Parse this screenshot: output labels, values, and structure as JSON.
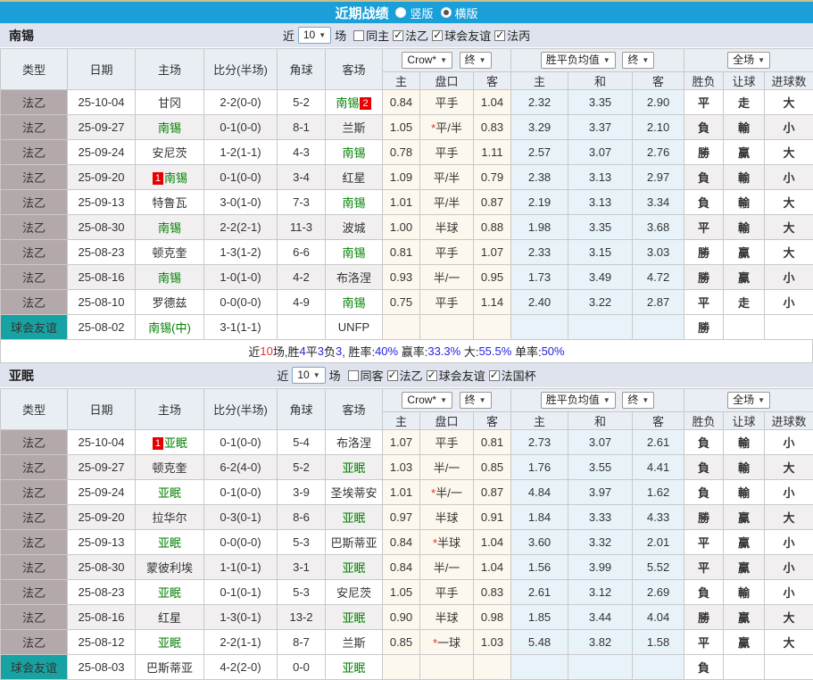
{
  "title_bar": {
    "title": "近期战绩",
    "radios": [
      {
        "label": "竖版",
        "checked": false
      },
      {
        "label": "横版",
        "checked": true
      }
    ]
  },
  "header": {
    "type": "类型",
    "date": "日期",
    "home_field": "主场",
    "score": "比分(半场)",
    "corners": "角球",
    "away_field": "客场",
    "home": "主",
    "handicap": "盘口",
    "away": "客",
    "draw": "和",
    "wdl": "胜负",
    "handicap_result": "让球",
    "goals": "进球数",
    "book": "Crow*",
    "final": "终",
    "avg": "胜平负均值",
    "full": "全场"
  },
  "colors": {
    "titlebar_blue": "#1b9fd8",
    "league_cell": "#b3a9ab",
    "friendly_cell": "#17a3a3",
    "score_red": "#e62e2e",
    "team_green": "#008000",
    "win_red": "#cc0000",
    "lose_green": "#008000",
    "draw_blue": "#0000e0",
    "odds_cream_bg": "#fcf8ed",
    "odds_blue_bg": "#e8f3f9"
  },
  "sections": [
    {
      "team": "南锡",
      "filters": {
        "near": "近",
        "count": "10",
        "matches": "场",
        "checks": [
          {
            "label": "同主",
            "checked": false
          },
          {
            "label": "法乙",
            "checked": true
          },
          {
            "label": "球会友谊",
            "checked": true
          },
          {
            "label": "法丙",
            "checked": true
          }
        ]
      },
      "rows": [
        {
          "type": "法乙",
          "date": "25-10-04",
          "home": {
            "t": "甘冈"
          },
          "score": "2-2(0-0)",
          "corner": "5-2",
          "away": {
            "t": "南锡",
            "g": true,
            "br": "2"
          },
          "odds": [
            "0.84",
            "平手",
            "1.04",
            "2.32",
            "3.35",
            "2.90"
          ],
          "results": [
            [
              "平",
              "b"
            ],
            [
              "走",
              "b"
            ],
            [
              "大",
              "r"
            ]
          ]
        },
        {
          "type": "法乙",
          "date": "25-09-27",
          "home": {
            "t": "南锡",
            "g": true
          },
          "score": "0-1(0-0)",
          "corner": "8-1",
          "away": {
            "t": "兰斯"
          },
          "odds": [
            "1.05",
            "*平/半",
            "0.83",
            "3.29",
            "3.37",
            "2.10"
          ],
          "results": [
            [
              "負",
              "g"
            ],
            [
              "輸",
              "g"
            ],
            [
              "小",
              "g"
            ]
          ]
        },
        {
          "type": "法乙",
          "date": "25-09-24",
          "home": {
            "t": "安尼茨"
          },
          "score": "1-2(1-1)",
          "corner": "4-3",
          "away": {
            "t": "南锡",
            "g": true
          },
          "odds": [
            "0.78",
            "平手",
            "1.11",
            "2.57",
            "3.07",
            "2.76"
          ],
          "results": [
            [
              "勝",
              "r"
            ],
            [
              "贏",
              "r"
            ],
            [
              "大",
              "r"
            ]
          ]
        },
        {
          "type": "法乙",
          "date": "25-09-20",
          "home": {
            "t": "南锡",
            "g": true,
            "bl": "1"
          },
          "score": "0-1(0-0)",
          "corner": "3-4",
          "away": {
            "t": "红星"
          },
          "odds": [
            "1.09",
            "平/半",
            "0.79",
            "2.38",
            "3.13",
            "2.97"
          ],
          "results": [
            [
              "負",
              "g"
            ],
            [
              "輸",
              "g"
            ],
            [
              "小",
              "g"
            ]
          ]
        },
        {
          "type": "法乙",
          "date": "25-09-13",
          "home": {
            "t": "特鲁瓦"
          },
          "score": "3-0(1-0)",
          "corner": "7-3",
          "away": {
            "t": "南锡",
            "g": true
          },
          "odds": [
            "1.01",
            "平/半",
            "0.87",
            "2.19",
            "3.13",
            "3.34"
          ],
          "results": [
            [
              "負",
              "g"
            ],
            [
              "輸",
              "g"
            ],
            [
              "大",
              "r"
            ]
          ]
        },
        {
          "type": "法乙",
          "date": "25-08-30",
          "home": {
            "t": "南锡",
            "g": true
          },
          "score": "2-2(2-1)",
          "corner": "11-3",
          "away": {
            "t": "波城"
          },
          "odds": [
            "1.00",
            "半球",
            "0.88",
            "1.98",
            "3.35",
            "3.68"
          ],
          "results": [
            [
              "平",
              "b"
            ],
            [
              "輸",
              "g"
            ],
            [
              "大",
              "r"
            ]
          ]
        },
        {
          "type": "法乙",
          "date": "25-08-23",
          "home": {
            "t": "顿克奎"
          },
          "score": "1-3(1-2)",
          "corner": "6-6",
          "away": {
            "t": "南锡",
            "g": true
          },
          "odds": [
            "0.81",
            "平手",
            "1.07",
            "2.33",
            "3.15",
            "3.03"
          ],
          "results": [
            [
              "勝",
              "r"
            ],
            [
              "贏",
              "r"
            ],
            [
              "大",
              "r"
            ]
          ]
        },
        {
          "type": "法乙",
          "date": "25-08-16",
          "home": {
            "t": "南锡",
            "g": true
          },
          "score": "1-0(1-0)",
          "corner": "4-2",
          "away": {
            "t": "布洛涅"
          },
          "odds": [
            "0.93",
            "半/一",
            "0.95",
            "1.73",
            "3.49",
            "4.72"
          ],
          "results": [
            [
              "勝",
              "r"
            ],
            [
              "贏",
              "r"
            ],
            [
              "小",
              "g"
            ]
          ]
        },
        {
          "type": "法乙",
          "date": "25-08-10",
          "home": {
            "t": "罗德兹"
          },
          "score": "0-0(0-0)",
          "corner": "4-9",
          "away": {
            "t": "南锡",
            "g": true
          },
          "odds": [
            "0.75",
            "平手",
            "1.14",
            "2.40",
            "3.22",
            "2.87"
          ],
          "results": [
            [
              "平",
              "b"
            ],
            [
              "走",
              "b"
            ],
            [
              "小",
              "g"
            ]
          ]
        },
        {
          "type": "球会友谊",
          "friendly": true,
          "date": "25-08-02",
          "home": {
            "t": "南锡(中)",
            "g": true
          },
          "score": "3-1(1-1)",
          "corner": "",
          "away": {
            "t": "UNFP"
          },
          "odds": [
            "",
            "",
            "",
            "",
            "",
            ""
          ],
          "results": [
            [
              "勝",
              "r"
            ],
            [
              "",
              ""
            ],
            [
              "",
              ""
            ]
          ]
        }
      ],
      "summary": [
        {
          "t": "近",
          "c": "k"
        },
        {
          "t": "10",
          "c": "r"
        },
        {
          "t": "场,胜",
          "c": "k"
        },
        {
          "t": "4",
          "c": "b"
        },
        {
          "t": "平",
          "c": "k"
        },
        {
          "t": "3",
          "c": "b"
        },
        {
          "t": "负",
          "c": "k"
        },
        {
          "t": "3",
          "c": "b"
        },
        {
          "t": ", 胜率:",
          "c": "k"
        },
        {
          "t": "40%",
          "c": "b"
        },
        {
          "t": " 赢率:",
          "c": "k"
        },
        {
          "t": "33.3%",
          "c": "b"
        },
        {
          "t": " 大:",
          "c": "k"
        },
        {
          "t": "55.5%",
          "c": "b"
        },
        {
          "t": " 单率:",
          "c": "k"
        },
        {
          "t": "50%",
          "c": "b"
        }
      ]
    },
    {
      "team": "亚眠",
      "filters": {
        "near": "近",
        "count": "10",
        "matches": "场",
        "checks": [
          {
            "label": "同客",
            "checked": false
          },
          {
            "label": "法乙",
            "checked": true
          },
          {
            "label": "球会友谊",
            "checked": true
          },
          {
            "label": "法国杯",
            "checked": true
          }
        ]
      },
      "rows": [
        {
          "type": "法乙",
          "date": "25-10-04",
          "home": {
            "t": "亚眠",
            "g": true,
            "bl": "1"
          },
          "score": "0-1(0-0)",
          "corner": "5-4",
          "away": {
            "t": "布洛涅"
          },
          "odds": [
            "1.07",
            "平手",
            "0.81",
            "2.73",
            "3.07",
            "2.61"
          ],
          "results": [
            [
              "負",
              "g"
            ],
            [
              "輸",
              "g"
            ],
            [
              "小",
              "g"
            ]
          ]
        },
        {
          "type": "法乙",
          "date": "25-09-27",
          "home": {
            "t": "顿克奎"
          },
          "score": "6-2(4-0)",
          "corner": "5-2",
          "away": {
            "t": "亚眠",
            "g": true
          },
          "odds": [
            "1.03",
            "半/一",
            "0.85",
            "1.76",
            "3.55",
            "4.41"
          ],
          "results": [
            [
              "負",
              "g"
            ],
            [
              "輸",
              "g"
            ],
            [
              "大",
              "r"
            ]
          ]
        },
        {
          "type": "法乙",
          "date": "25-09-24",
          "home": {
            "t": "亚眠",
            "g": true
          },
          "score": "0-1(0-0)",
          "corner": "3-9",
          "away": {
            "t": "圣埃蒂安"
          },
          "odds": [
            "1.01",
            "*半/一",
            "0.87",
            "4.84",
            "3.97",
            "1.62"
          ],
          "results": [
            [
              "負",
              "g"
            ],
            [
              "輸",
              "g"
            ],
            [
              "小",
              "g"
            ]
          ]
        },
        {
          "type": "法乙",
          "date": "25-09-20",
          "home": {
            "t": "拉华尔"
          },
          "score": "0-3(0-1)",
          "corner": "8-6",
          "away": {
            "t": "亚眠",
            "g": true
          },
          "odds": [
            "0.97",
            "半球",
            "0.91",
            "1.84",
            "3.33",
            "4.33"
          ],
          "results": [
            [
              "勝",
              "r"
            ],
            [
              "贏",
              "r"
            ],
            [
              "大",
              "r"
            ]
          ]
        },
        {
          "type": "法乙",
          "date": "25-09-13",
          "home": {
            "t": "亚眠",
            "g": true
          },
          "score": "0-0(0-0)",
          "corner": "5-3",
          "away": {
            "t": "巴斯蒂亚"
          },
          "odds": [
            "0.84",
            "*半球",
            "1.04",
            "3.60",
            "3.32",
            "2.01"
          ],
          "results": [
            [
              "平",
              "b"
            ],
            [
              "贏",
              "r"
            ],
            [
              "小",
              "g"
            ]
          ]
        },
        {
          "type": "法乙",
          "date": "25-08-30",
          "home": {
            "t": "蒙彼利埃"
          },
          "score": "1-1(0-1)",
          "corner": "3-1",
          "away": {
            "t": "亚眠",
            "g": true
          },
          "odds": [
            "0.84",
            "半/一",
            "1.04",
            "1.56",
            "3.99",
            "5.52"
          ],
          "results": [
            [
              "平",
              "b"
            ],
            [
              "贏",
              "r"
            ],
            [
              "小",
              "g"
            ]
          ]
        },
        {
          "type": "法乙",
          "date": "25-08-23",
          "home": {
            "t": "亚眠",
            "g": true
          },
          "score": "0-1(0-1)",
          "corner": "5-3",
          "away": {
            "t": "安尼茨"
          },
          "odds": [
            "1.05",
            "平手",
            "0.83",
            "2.61",
            "3.12",
            "2.69"
          ],
          "results": [
            [
              "負",
              "g"
            ],
            [
              "輸",
              "g"
            ],
            [
              "小",
              "g"
            ]
          ]
        },
        {
          "type": "法乙",
          "date": "25-08-16",
          "home": {
            "t": "红星"
          },
          "score": "1-3(0-1)",
          "corner": "13-2",
          "away": {
            "t": "亚眠",
            "g": true
          },
          "odds": [
            "0.90",
            "半球",
            "0.98",
            "1.85",
            "3.44",
            "4.04"
          ],
          "results": [
            [
              "勝",
              "r"
            ],
            [
              "贏",
              "r"
            ],
            [
              "大",
              "r"
            ]
          ]
        },
        {
          "type": "法乙",
          "date": "25-08-12",
          "home": {
            "t": "亚眠",
            "g": true
          },
          "score": "2-2(1-1)",
          "corner": "8-7",
          "away": {
            "t": "兰斯"
          },
          "odds": [
            "0.85",
            "*一球",
            "1.03",
            "5.48",
            "3.82",
            "1.58"
          ],
          "results": [
            [
              "平",
              "b"
            ],
            [
              "贏",
              "r"
            ],
            [
              "大",
              "r"
            ]
          ]
        },
        {
          "type": "球会友谊",
          "friendly": true,
          "date": "25-08-03",
          "home": {
            "t": "巴斯蒂亚"
          },
          "score": "4-2(2-0)",
          "corner": "0-0",
          "away": {
            "t": "亚眠",
            "g": true
          },
          "odds": [
            "",
            "",
            "",
            "",
            "",
            ""
          ],
          "results": [
            [
              "負",
              "g"
            ],
            [
              "",
              ""
            ],
            [
              "",
              ""
            ]
          ]
        }
      ],
      "summary": []
    }
  ]
}
